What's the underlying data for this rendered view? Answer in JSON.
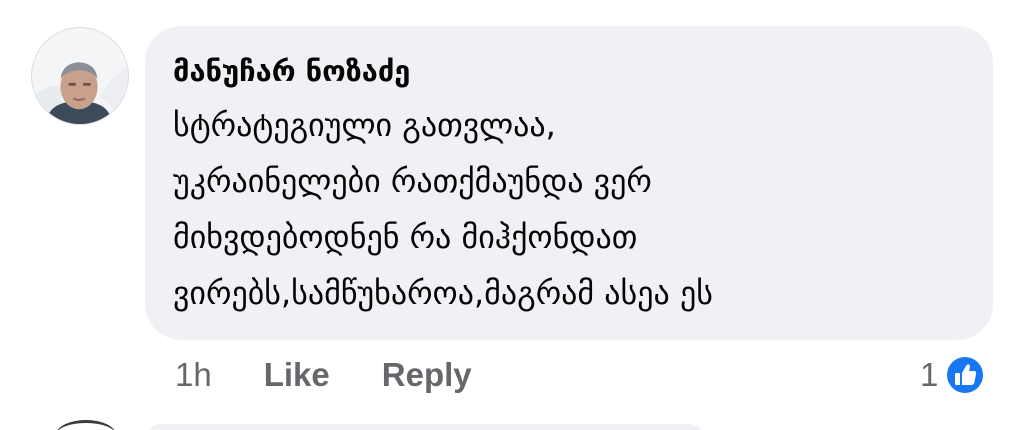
{
  "comment": {
    "author": "მანუჩარ ნოზაძე",
    "text": "სტრატეგიული გათვლაა,\nუკრაინელები რათქმაუნდა ვერ\nმიხვდებოდნენ რა მიჰქონდათ\nვირებს,სამწუხაროა,მაგრამ ასეა ეს",
    "time": "1h",
    "like_label": "Like",
    "reply_label": "Reply",
    "reaction_count": "1",
    "reaction_icon": "like-icon",
    "colors": {
      "bubble": "#eff1f4",
      "secondary_text": "#65676b",
      "like_blue": "#1877f2"
    }
  }
}
